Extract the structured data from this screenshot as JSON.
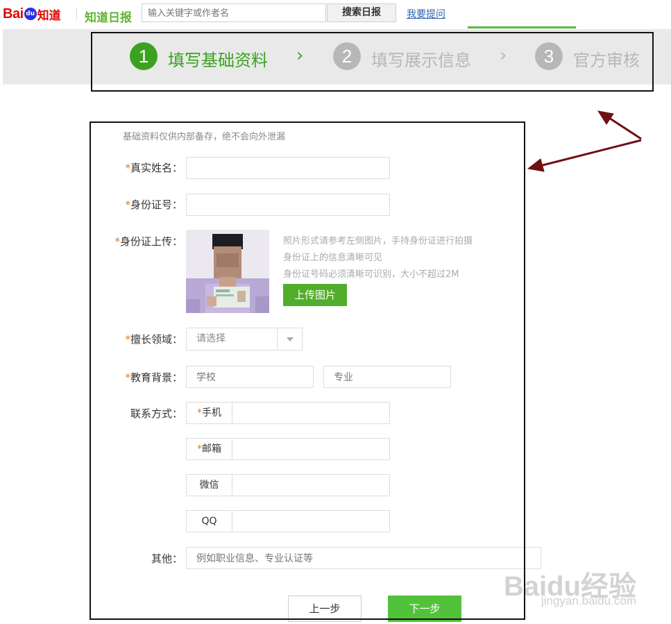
{
  "header": {
    "logo": {
      "part1": "Bai",
      "part2": "du",
      "part3": "知道"
    },
    "sub_logo": "知道日报",
    "search_placeholder": "输入关键字或作者名",
    "search_button": "搜索日报",
    "ask_link": "我要提问"
  },
  "steps": [
    {
      "number": "1",
      "label": "填写基础资料",
      "state": "active"
    },
    {
      "number": "2",
      "label": "填写展示信息",
      "state": "inactive"
    },
    {
      "number": "3",
      "label": "官方审核",
      "state": "inactive"
    }
  ],
  "step_separator": "›",
  "colors": {
    "active_green": "#3aa220",
    "inactive_gray": "#b7b7b7",
    "required": "#e27b13",
    "button_green": "#52ad2a",
    "annotation_arrow": "#6f0f0f"
  },
  "form": {
    "note": "基础资料仅供内部备存，绝不会向外泄漏",
    "required_mark": "*",
    "real_name_label": "真实姓名：",
    "id_number_label": "身份证号：",
    "id_upload_label": "身份证上传：",
    "upload_hints": [
      "照片形式请参考左侧图片，手持身份证进行拍摄",
      "身份证上的信息清晰可见",
      "身份证号码必须清晰可识别，大小不超过2M"
    ],
    "upload_button": "上传图片",
    "field_label": "擅长领域：",
    "field_select_value": "请选择",
    "education_label": "教育背景：",
    "school_placeholder": "学校",
    "major_placeholder": "专业",
    "contact_label": "联系方式：",
    "contacts": [
      {
        "label": "手机",
        "required": true
      },
      {
        "label": "邮箱",
        "required": true
      },
      {
        "label": "微信",
        "required": false
      },
      {
        "label": "QQ",
        "required": false
      }
    ],
    "other_label": "其他：",
    "other_placeholder": "例如职业信息、专业认证等",
    "prev_button": "上一步",
    "next_button": "下一步"
  },
  "watermark": {
    "main": "Baidu经验",
    "sub": "jingyan.baidu.com"
  }
}
